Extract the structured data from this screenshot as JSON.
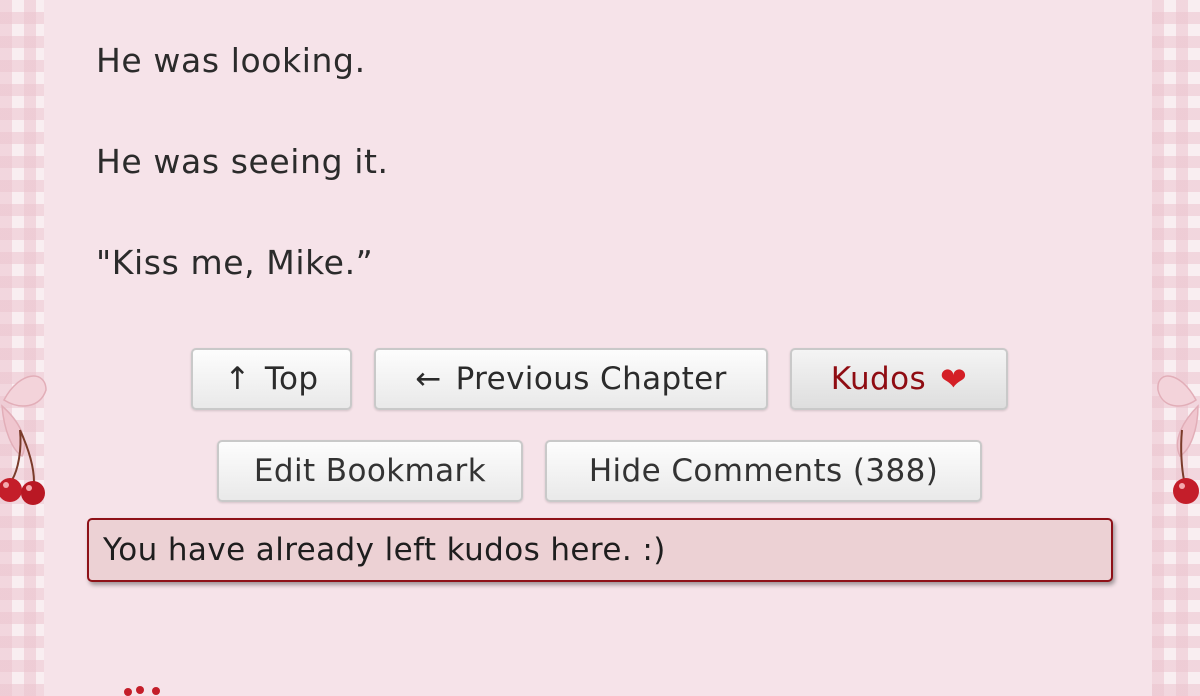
{
  "story": {
    "lines": [
      "He was looking.",
      "He was seeing it.",
      "\"Kiss me, Mike.”"
    ]
  },
  "navigation": {
    "top_arrow": "↑",
    "top_label": "Top",
    "prev_arrow": "←",
    "prev_label": "Previous Chapter",
    "kudos_label": "Kudos",
    "kudos_heart": "❤"
  },
  "actions": {
    "edit_bookmark_label": "Edit Bookmark",
    "hide_comments_label": "Hide Comments (388)"
  },
  "notice": {
    "text": "You have already left kudos here. :)"
  },
  "colors": {
    "background": "#f6e3e9",
    "kudos_text": "#8f0c12",
    "heart": "#d41f26",
    "notice_border": "#8e1118",
    "notice_background": "#ecd1d4"
  }
}
